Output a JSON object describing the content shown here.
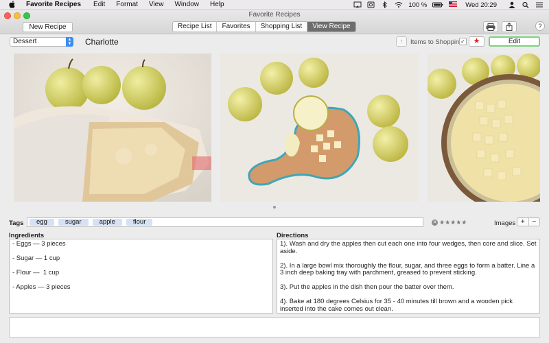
{
  "menubar": {
    "app_name": "Favorite Recipes",
    "items": [
      "Edit",
      "Format",
      "View",
      "Window",
      "Help"
    ],
    "battery": "100 %",
    "clock": "Wed 20:29"
  },
  "window": {
    "title": "Favorite Recipes",
    "new_recipe_label": "New Recipe",
    "tabs": [
      {
        "label": "Recipe List",
        "active": false
      },
      {
        "label": "Favorites",
        "active": false
      },
      {
        "label": "Shopping List",
        "active": false
      },
      {
        "label": "View Recipe",
        "active": true
      }
    ],
    "help_label": "?"
  },
  "recipe": {
    "category": "Dessert",
    "title": "Charlotte",
    "items_to_shopping_label": "Items to Shopping",
    "items_to_shopping_checked": true,
    "favorite_icon": "★",
    "edit_label": "Edit",
    "tags_label": "Tags",
    "tags": [
      "egg",
      "sugar",
      "apple",
      "flour"
    ],
    "rating_stars": "★★★★★",
    "rating_value": 0,
    "images_label": "Images",
    "images_add": "+",
    "images_remove": "−",
    "ingredients_label": "Ingredients",
    "ingredients": [
      "- Eggs — 3 pieces",
      "- Sugar — 1 cup",
      "- Flour —  1 cup",
      "- Apples — 3 pieces"
    ],
    "directions_label": "Directions",
    "directions": [
      "1). Wash and dry the apples then cut each one into four wedges, then core and slice. Set aside.",
      "2). In a large bowl mix thoroughly the flour, sugar, and three eggs to form a batter. Line a 3 inch deep baking tray with parchment, greased to prevent sticking.",
      "3). Put the apples in the dish then pour the batter over them.",
      "4). Bake at 180 degrees Celsius for 35 - 40 minutes till brown and a wooden pick inserted into the cake comes out clean."
    ],
    "notes": ""
  },
  "colors": {
    "accent": "#3b8df3",
    "favorite": "#e02020",
    "edit_border": "#7fd27a"
  }
}
